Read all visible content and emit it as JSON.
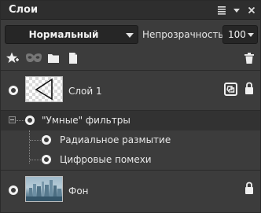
{
  "panel": {
    "title": "Слои"
  },
  "toolbar": {
    "blend_mode": "Нормальный",
    "opacity_label": "Непрозрачность",
    "opacity_value": "100"
  },
  "layers": [
    {
      "name": "Слой 1"
    },
    {
      "smart_filters_label": "\"Умные\" фильтры",
      "filters": [
        "Радиальное размытие",
        "Цифровые помехи"
      ]
    },
    {
      "name": "Фон"
    }
  ],
  "colors": {
    "panel_bg": "#3c3c3c",
    "header_bg": "#2e2e2e",
    "selected_row": "#323232"
  }
}
